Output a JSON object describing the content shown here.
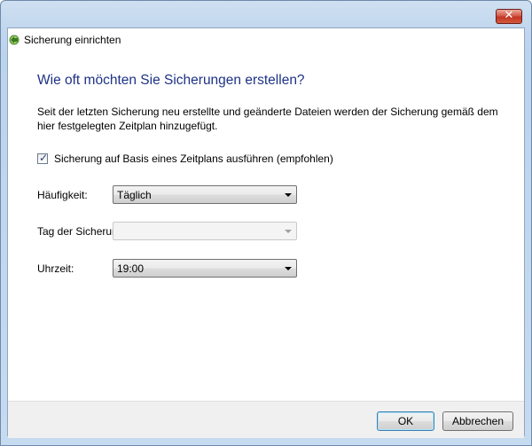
{
  "header": {
    "title": "Sicherung einrichten"
  },
  "main": {
    "heading": "Wie oft möchten Sie Sicherungen erstellen?",
    "description": "Seit der letzten Sicherung neu erstellte und geänderte Dateien werden der Sicherung gemäß dem hier festgelegten Zeitplan hinzugefügt.",
    "schedule_checkbox": {
      "label": "Sicherung auf Basis eines Zeitplans ausführen (empfohlen)",
      "checked": true
    },
    "frequency": {
      "label": "Häufigkeit:",
      "value": "Täglich"
    },
    "day": {
      "label": "Tag der Sicherun",
      "value": "",
      "disabled": true
    },
    "time": {
      "label": "Uhrzeit:",
      "value": "19:00"
    }
  },
  "footer": {
    "ok_label": "OK",
    "cancel_label": "Abbrechen"
  },
  "colors": {
    "heading": "#1e3287",
    "frame": "#c2d7ee",
    "close": "#c13524"
  }
}
